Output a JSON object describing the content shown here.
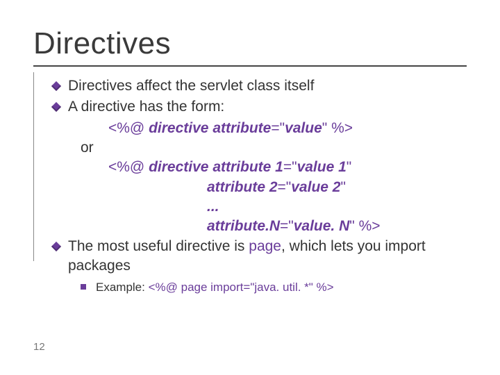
{
  "title": "Directives",
  "bullets": {
    "b1": "Directives affect the servlet class itself",
    "b2": "A directive has the form:",
    "b3_pre": "The most useful directive is ",
    "b3_page": "page",
    "b3_post": ", which lets you import packages"
  },
  "code": {
    "open": "<%@ ",
    "close": " %>",
    "directive": "directive",
    "attribute": "attribute",
    "value": "value",
    "eq": "=",
    "q": "\"",
    "or": "or",
    "attribute1": "attribute 1",
    "value1": "value 1",
    "attribute2": "attribute 2",
    "value2": "value 2",
    "dots": "...",
    "attributeN": "attribute.N",
    "valueN": "value. N"
  },
  "example": {
    "label": "Example:  ",
    "code": "<%@ page import=\"java. util. *\" %>"
  },
  "page_number": "12"
}
